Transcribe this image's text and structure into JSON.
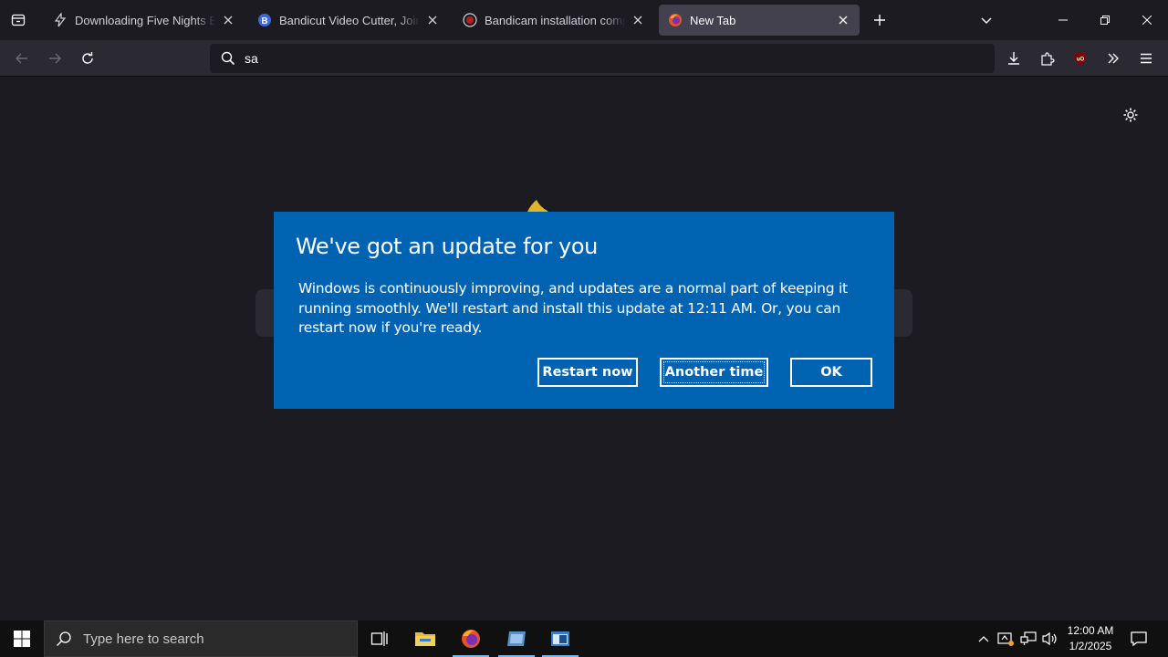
{
  "browser": {
    "tabs": [
      {
        "title": "Downloading Five Nights Befor",
        "icon": "lightning-icon"
      },
      {
        "title": "Bandicut Video Cutter, Joiner a",
        "icon": "bandicut-icon"
      },
      {
        "title": "Bandicam installation complete",
        "icon": "bandicam-icon"
      },
      {
        "title": "New Tab",
        "icon": "firefox-icon"
      }
    ],
    "url_value": "sa"
  },
  "dialog": {
    "title": "We've got an update for you",
    "body": "Windows is continuously improving, and updates are a normal part of keeping it running smoothly. We'll restart and install this update at 12:11 AM. Or, you can restart now if you're ready.",
    "buttons": {
      "restart": "Restart now",
      "another": "Another time",
      "ok": "OK"
    }
  },
  "taskbar": {
    "search_placeholder": "Type here to search",
    "time": "12:00 AM",
    "date": "1/2/2025"
  },
  "colors": {
    "dialog_bg": "#0063b1",
    "browser_bg": "#1c1b22",
    "toolbar": "#2b2a33"
  }
}
